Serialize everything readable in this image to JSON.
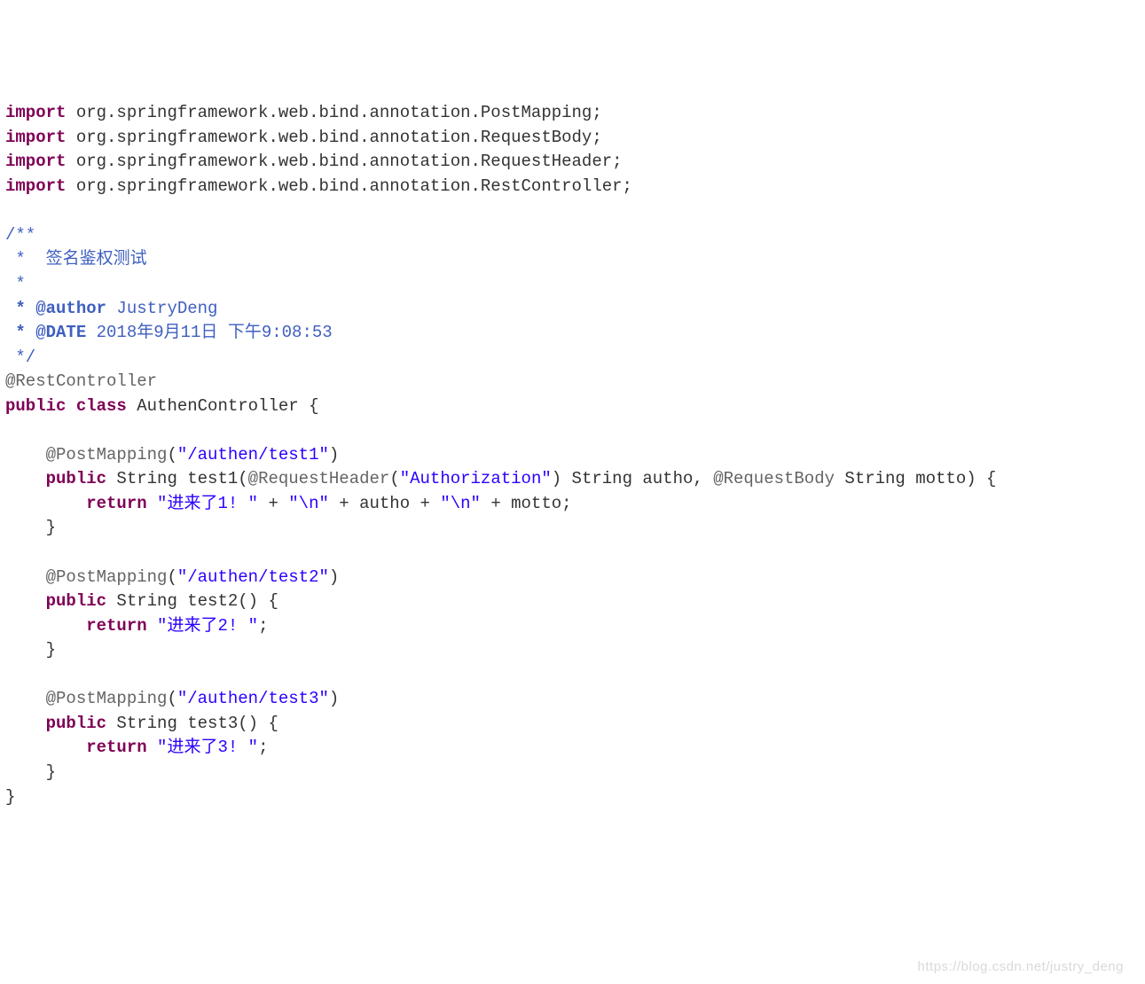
{
  "imports": {
    "kw": "import",
    "lines": [
      "org.springframework.web.bind.annotation.PostMapping;",
      "org.springframework.web.bind.annotation.RequestBody;",
      "org.springframework.web.bind.annotation.RequestHeader;",
      "org.springframework.web.bind.annotation.RestController;"
    ]
  },
  "javadoc": {
    "open": "/**",
    "star": " *",
    "desc": " *  签名鉴权测试",
    "blank": " *",
    "author_tag": " * @author",
    "author_name": " JustryDeng",
    "date_tag": " * @DATE",
    "date_val": " 2018年9月11日 下午9:08:53",
    "close": " */"
  },
  "class_anno": "@RestController",
  "class_decl": {
    "public": "public",
    "class": "class",
    "name": " AuthenController {"
  },
  "m1": {
    "anno_name": "@PostMapping",
    "anno_open": "(",
    "anno_arg": "\"/authen/test1\"",
    "anno_close": ")",
    "sig_public": "public",
    "sig_type": " String test1(",
    "rh_anno": "@RequestHeader",
    "rh_open": "(",
    "rh_arg": "\"Authorization\"",
    "rh_close": ")",
    "rh_rest": " String autho, ",
    "rb_anno": "@RequestBody",
    "rb_rest": " String motto) {",
    "ret_kw": "return",
    "s1": " \"进来了1! \"",
    "p1": " + ",
    "s2": "\"\\n\"",
    "p2": " + autho + ",
    "s3": "\"\\n\"",
    "p3": " + motto;",
    "close": "}"
  },
  "m2": {
    "anno_name": "@PostMapping",
    "anno_open": "(",
    "anno_arg": "\"/authen/test2\"",
    "anno_close": ")",
    "sig_public": "public",
    "sig_rest": " String test2() {",
    "ret_kw": "return",
    "ret_str": " \"进来了2! \"",
    "semi": ";",
    "close": "}"
  },
  "m3": {
    "anno_name": "@PostMapping",
    "anno_open": "(",
    "anno_arg": "\"/authen/test3\"",
    "anno_close": ")",
    "sig_public": "public",
    "sig_rest": " String test3() {",
    "ret_kw": "return",
    "ret_str": " \"进来了3! \"",
    "semi": ";",
    "close": "}"
  },
  "class_close": "}",
  "watermark": "https://blog.csdn.net/justry_deng"
}
